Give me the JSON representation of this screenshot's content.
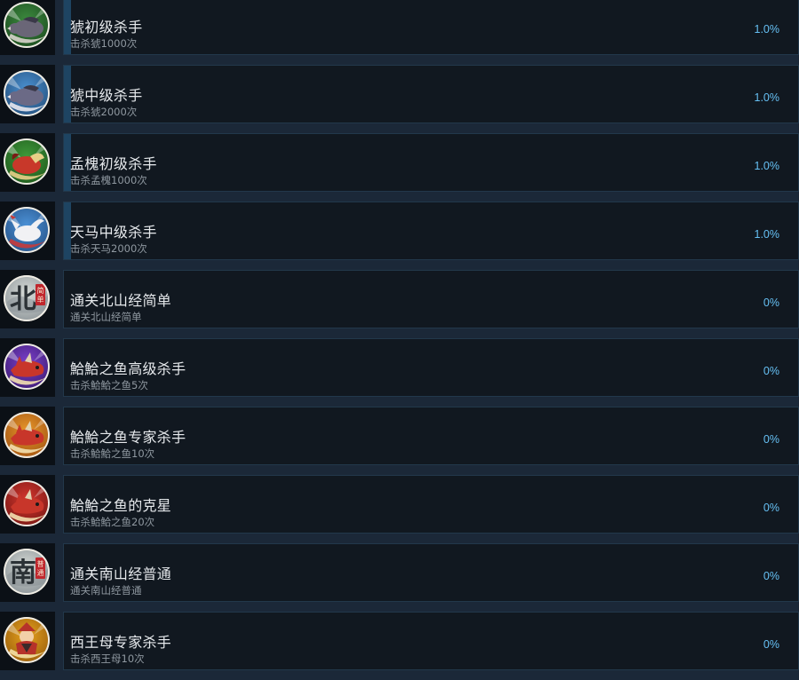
{
  "achievements": [
    {
      "title": "猇初级杀手",
      "description": "击杀猇1000次",
      "percent": "1.0%",
      "progress": 0.01,
      "icon": "boar-beast-icon",
      "colors": {
        "bg": "#3c8a3e",
        "bg2": "#1d4d20",
        "creature": "#6a6677",
        "accent": "#d8d4cc"
      }
    },
    {
      "title": "猇中级杀手",
      "description": "击杀猇2000次",
      "percent": "1.0%",
      "progress": 0.01,
      "icon": "boar-beast-icon",
      "colors": {
        "bg": "#4a90d0",
        "bg2": "#24507d",
        "creature": "#6b6a86",
        "accent": "#e8e8ee"
      }
    },
    {
      "title": "孟槐初级杀手",
      "description": "击杀孟槐1000次",
      "percent": "1.0%",
      "progress": 0.01,
      "icon": "red-beast-icon",
      "colors": {
        "bg": "#3f9a3a",
        "bg2": "#1f5a1d",
        "creature": "#c8382a",
        "accent": "#e8d088"
      }
    },
    {
      "title": "天马中级杀手",
      "description": "击杀天马2000次",
      "percent": "1.0%",
      "progress": 0.01,
      "icon": "white-horse-icon",
      "colors": {
        "bg": "#4b91d6",
        "bg2": "#27548a",
        "creature": "#f1f1f4",
        "accent": "#c83a3a"
      }
    },
    {
      "title": "通关北山经简单",
      "description": "通关北山经简单",
      "percent": "0%",
      "progress": 0,
      "icon": "north-scroll-icon",
      "glyph": "北",
      "seal": "简单",
      "colors": {
        "bg": "#d8dcd8",
        "bg2": "#8e969a",
        "creature": "#2c3236",
        "accent": "#c0272d"
      }
    },
    {
      "title": "鮯鮯之鱼高级杀手",
      "description": "击杀鮯鮯之鱼5次",
      "percent": "0%",
      "progress": 0,
      "icon": "fish-beast-icon",
      "colors": {
        "bg": "#7a3fc9",
        "bg2": "#3f1d76",
        "creature": "#c8362a",
        "accent": "#f3e0b0"
      }
    },
    {
      "title": "鮯鮯之鱼专家杀手",
      "description": "击杀鮯鮯之鱼10次",
      "percent": "0%",
      "progress": 0,
      "icon": "fish-beast-icon",
      "colors": {
        "bg": "#e7962a",
        "bg2": "#a35512",
        "creature": "#c8362a",
        "accent": "#f3e0b0"
      }
    },
    {
      "title": "鮯鮯之鱼的克星",
      "description": "击杀鮯鮯之鱼20次",
      "percent": "0%",
      "progress": 0,
      "icon": "fish-beast-icon",
      "colors": {
        "bg": "#d2362e",
        "bg2": "#7a1814",
        "creature": "#c8362a",
        "accent": "#f3e0b0"
      }
    },
    {
      "title": "通关南山经普通",
      "description": "通关南山经普通",
      "percent": "0%",
      "progress": 0,
      "icon": "south-scroll-icon",
      "glyph": "南",
      "seal": "普通",
      "colors": {
        "bg": "#d6dad6",
        "bg2": "#8a9296",
        "creature": "#2c3236",
        "accent": "#c0272d"
      }
    },
    {
      "title": "西王母专家杀手",
      "description": "击杀西王母10次",
      "percent": "0%",
      "progress": 0,
      "icon": "queen-mother-icon",
      "colors": {
        "bg": "#e6a21e",
        "bg2": "#9a5e0c",
        "creature": "#b6322a",
        "accent": "#f4dfa6"
      }
    }
  ]
}
